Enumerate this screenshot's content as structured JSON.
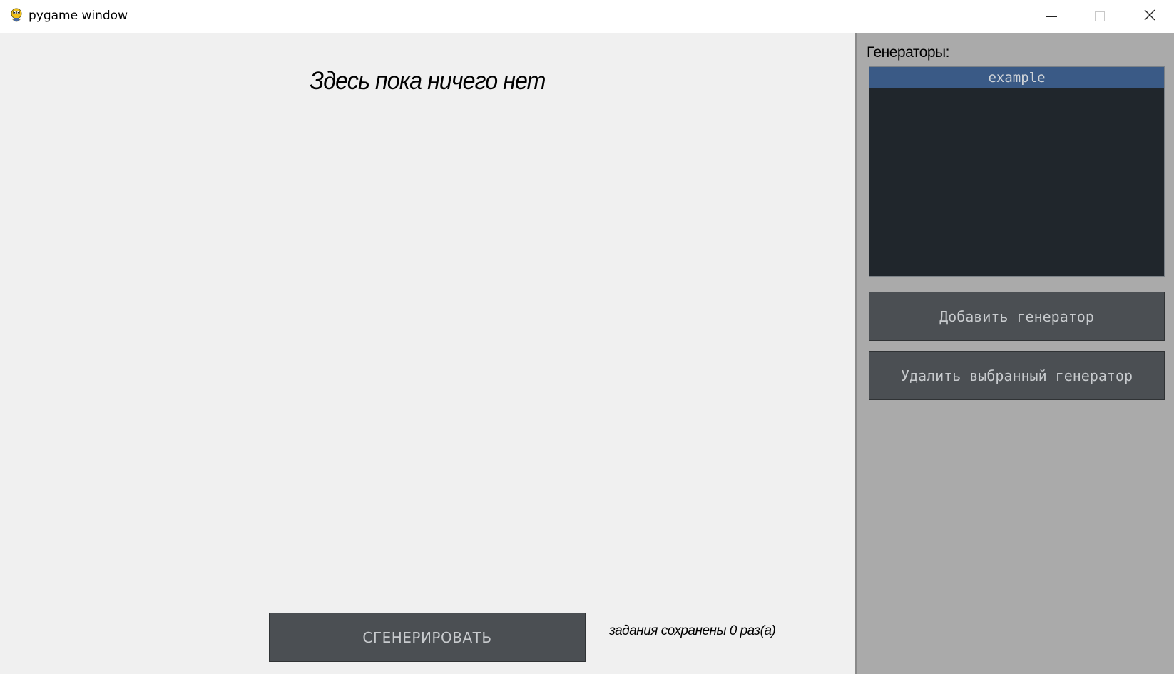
{
  "window": {
    "title": "pygame window",
    "icon": "pygame-snake-icon",
    "controls": {
      "minimize_icon": "minimize-icon",
      "maximize_icon": "maximize-icon",
      "close_icon": "close-icon"
    }
  },
  "main": {
    "empty_message": "Здесь пока ничего нет",
    "generate_button_label": "СГЕНЕРИРОВАТЬ",
    "saved_status": "задания сохранены 0 раз(а)"
  },
  "sidebar": {
    "generators_label": "Генераторы:",
    "generators": [
      {
        "name": "example",
        "selected": true
      }
    ],
    "add_button_label": "Добавить генератор",
    "remove_button_label": "Удалить выбранный генератор"
  },
  "colors": {
    "main_background": "#f0f0f0",
    "panel_background": "#aaaaaa",
    "button_background": "#4b4f53",
    "button_text": "#c8cbce",
    "list_background": "#20262c",
    "list_selected": "#3a5a86"
  }
}
